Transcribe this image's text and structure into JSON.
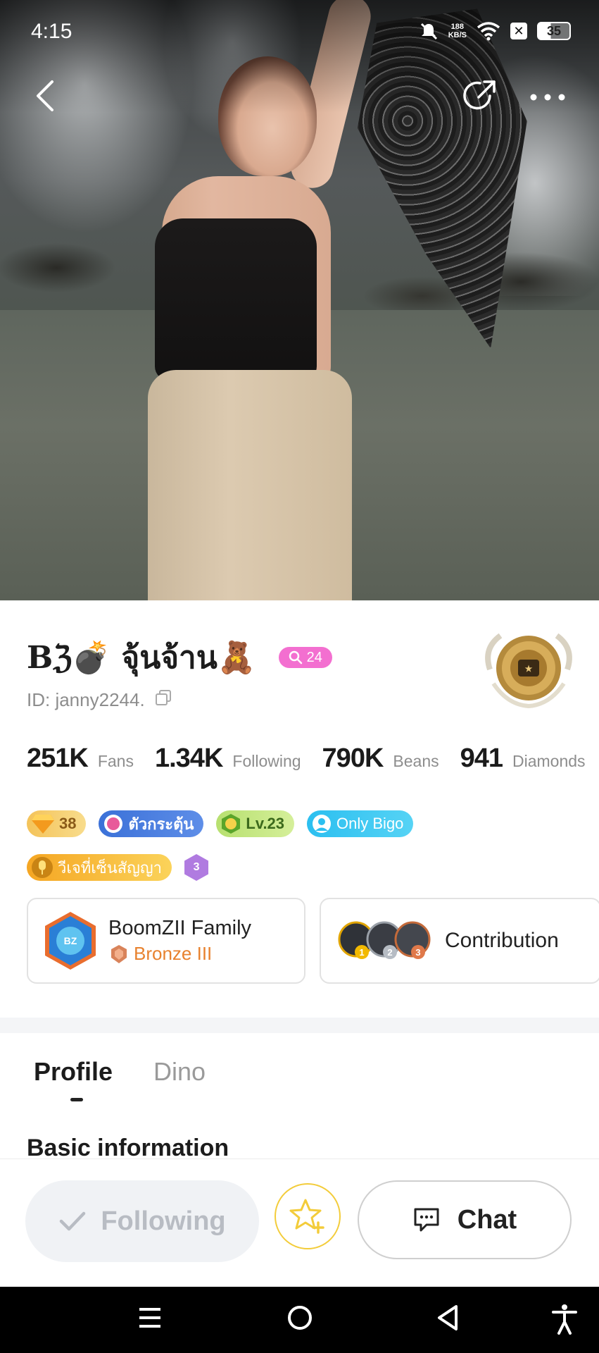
{
  "status_bar": {
    "time": "4:15",
    "network_speed_top": "188",
    "network_speed_bottom": "KB/S",
    "battery": "35"
  },
  "profile": {
    "display_name": "Bℨ💣 จุ้นจ้าน🧸",
    "search_badge_count": "24",
    "id_text": "ID: janny2244.",
    "stats": [
      {
        "value": "251K",
        "label": "Fans"
      },
      {
        "value": "1.34K",
        "label": "Following"
      },
      {
        "value": "790K",
        "label": "Beans"
      },
      {
        "value": "941",
        "label": "Diamonds"
      }
    ],
    "badges_row1": {
      "gem_value": "38",
      "thai_label": "ตัวกระตุ้น",
      "level_label": "Lv.23",
      "only_bigo_label": "Only Bigo"
    },
    "badges_row2": {
      "vj_label": "วีเจที่เซ็นสัญญา",
      "hex_value": "3"
    },
    "family_card": {
      "title": "BoomZII Family",
      "rank": "Bronze III"
    },
    "contribution_card": {
      "label": "Contribution",
      "ranks": [
        "1",
        "2",
        "3"
      ]
    }
  },
  "tabs": [
    {
      "label": "Profile",
      "active": true
    },
    {
      "label": "Dino",
      "active": false
    }
  ],
  "section": {
    "title": "Basic information"
  },
  "actions": {
    "following_label": "Following",
    "chat_label": "Chat"
  },
  "colors": {
    "accent_pink": "#f36fd0",
    "star_yellow": "#f3cc3a",
    "bronze_orange": "#e8822f"
  },
  "icons": [
    "back-icon",
    "share-icon",
    "more-icon",
    "copy-icon",
    "star-plus-icon",
    "chat-icon",
    "check-icon",
    "menu-icon",
    "home-icon",
    "back-triangle-icon",
    "accessibility-icon"
  ]
}
